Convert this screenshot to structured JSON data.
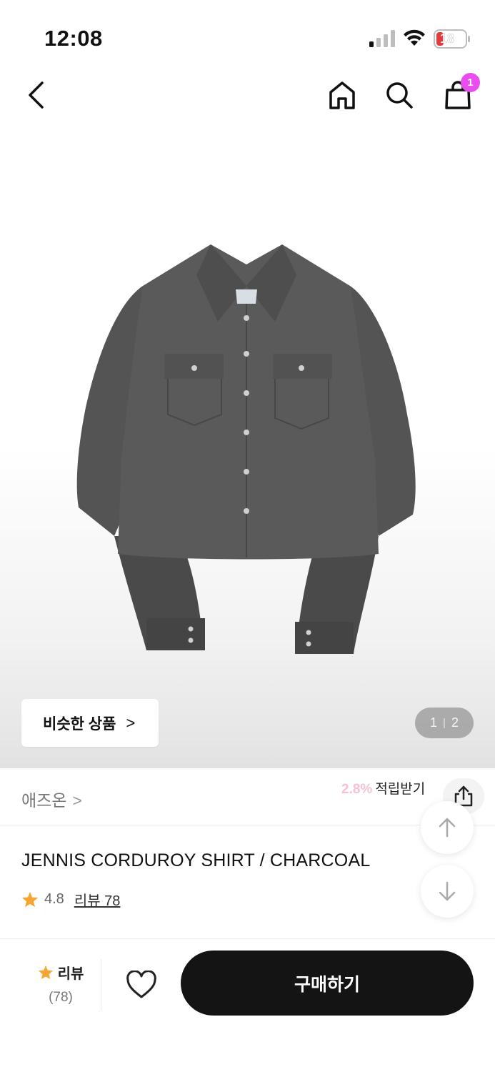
{
  "status_bar": {
    "time": "12:08",
    "battery_level": "18",
    "signal_icon": "cellular-signal-icon",
    "wifi_icon": "wifi-icon"
  },
  "nav": {
    "back_icon": "chevron-left-icon",
    "home_icon": "home-icon",
    "search_icon": "search-icon",
    "cart_icon": "shopping-bag-icon",
    "cart_count": "1",
    "badge_color": "#e94cef"
  },
  "gallery": {
    "similar_label": "비슷한 상품",
    "similar_chevron": ">",
    "current_page": "1",
    "page_separator": "|",
    "total_pages": "2",
    "image_subject": "charcoal-corduroy-shirt-image"
  },
  "brand": {
    "name": "애즈온",
    "chevron": ">",
    "point_percent": "2.8%",
    "point_label": "적립받기",
    "share_icon": "share-icon"
  },
  "scroll": {
    "up_icon": "arrow-up-icon",
    "down_icon": "arrow-down-icon"
  },
  "product": {
    "title": "JENNIS CORDUROY SHIRT / CHARCOAL",
    "rating": "4.8",
    "review_link": "리뷰 78",
    "star_color": "#f7a531"
  },
  "bottom_bar": {
    "review_label": "리뷰",
    "review_count": "(78)",
    "like_icon": "heart-icon",
    "buy_label": "구매하기"
  }
}
